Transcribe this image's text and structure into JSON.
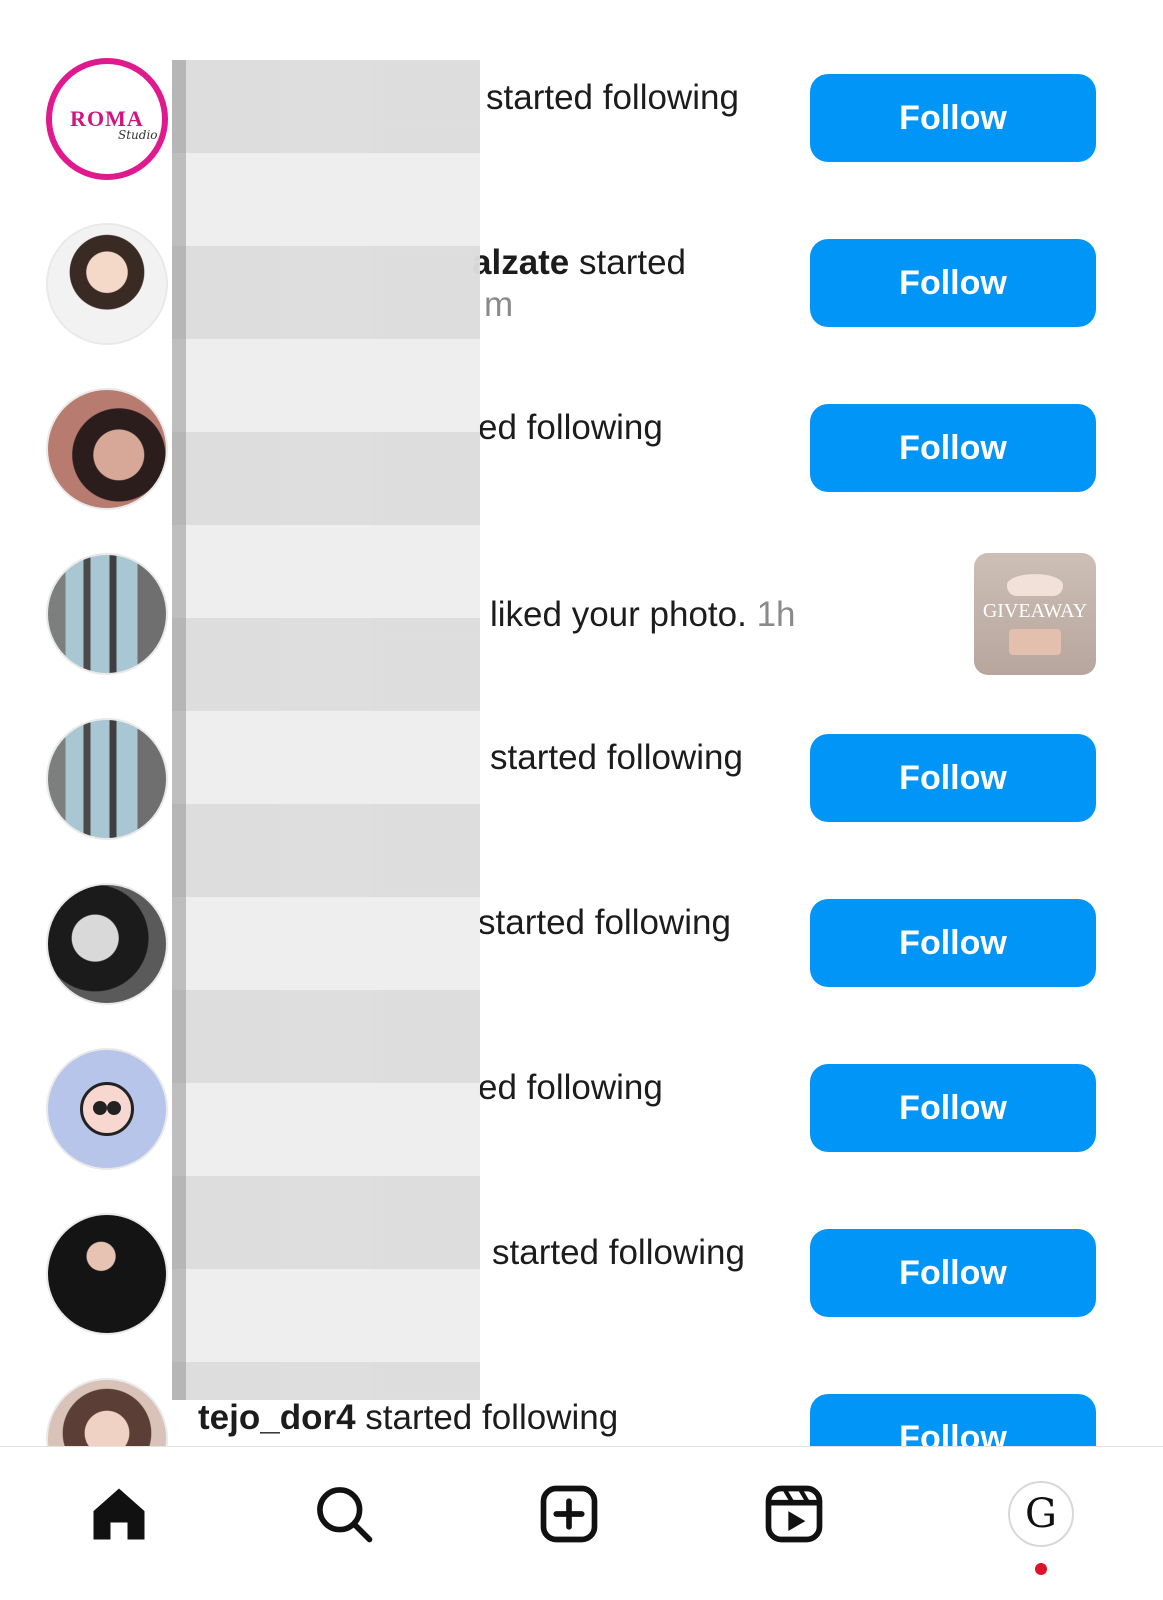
{
  "notifications": [
    {
      "text_bold": "",
      "text_rest": "started following",
      "subline": "",
      "action": "Follow",
      "roma_logo": "ROMA",
      "roma_sub": "Studio"
    },
    {
      "text_bold": "alzate",
      "text_rest": " started",
      "subline": "m",
      "action": "Follow"
    },
    {
      "text_bold": "",
      "text_rest": "ed following",
      "subline": "",
      "action": "Follow"
    },
    {
      "text_bold": "",
      "text_rest": "liked your photo.",
      "time": "1h",
      "thumb_text": "GIVEAWAY"
    },
    {
      "text_bold": "",
      "text_rest": "started following",
      "subline": "",
      "action": "Follow"
    },
    {
      "text_bold": "",
      "text_rest": "started following",
      "subline": "",
      "action": "Follow"
    },
    {
      "text_bold": "",
      "text_rest": "ed following",
      "subline": "",
      "action": "Follow"
    },
    {
      "text_bold": "",
      "text_rest": "started following",
      "subline": "",
      "action": "Follow"
    },
    {
      "text_bold": "tejo_dor4",
      "text_rest": " started following",
      "subline": "",
      "action": "Follow"
    }
  ],
  "tab_bar": {
    "items": [
      "home-icon",
      "search-icon",
      "create-icon",
      "reels-icon",
      "profile-avatar"
    ],
    "profile_initial": "G",
    "notification_dot_color": "#e0112b"
  },
  "colors": {
    "follow_button": "#0095f6"
  }
}
